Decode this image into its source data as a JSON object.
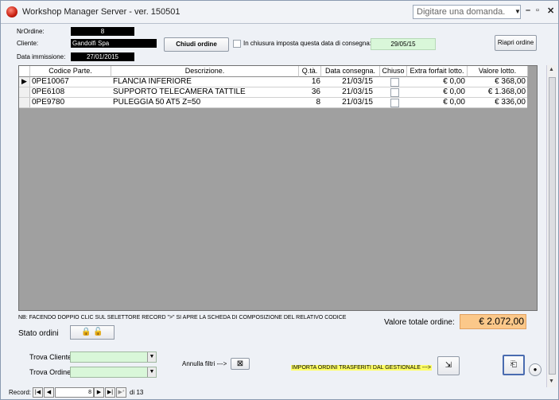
{
  "window": {
    "title": "Workshop Manager Server - ver. 150501",
    "help_placeholder": "Digitare una domanda.",
    "controls": {
      "minimize": "–",
      "restore": "▫",
      "close": "✕"
    }
  },
  "header": {
    "nr_ordine_label": "NrOrdine:",
    "nr_ordine_value": "8",
    "cliente_label": "Cliente:",
    "cliente_value": "Gandolfi Spa",
    "data_label": "Data immissione:",
    "data_value": "27/01/2015",
    "chiudi_button": "Chiudi ordine",
    "chiusura_label": "In chiusura imposta questa data di consegna:",
    "chiusura_date": "29/05/15",
    "riapri_button": "Riapri ordine"
  },
  "grid": {
    "columns": [
      "Codice Parte.",
      "Descrizione.",
      "Q.tà.",
      "Data consegna.",
      "Chiuso",
      "Extra forfait lotto.",
      "Valore lotto."
    ],
    "rows": [
      {
        "codice": "0PE10067",
        "descrizione": "FLANCIA INFERIORE",
        "qta": "16",
        "data": "21/03/15",
        "extra": "€ 0,00",
        "valore": "€ 368,00"
      },
      {
        "codice": "0PE6108",
        "descrizione": "SUPPORTO TELECAMERA TATTILE",
        "qta": "36",
        "data": "21/03/15",
        "extra": "€ 0,00",
        "valore": "€ 1.368,00"
      },
      {
        "codice": "0PE9780",
        "descrizione": "PULEGGIA 50 AT5 Z=50",
        "qta": "8",
        "data": "21/03/15",
        "extra": "€ 0,00",
        "valore": "€ 336,00"
      }
    ]
  },
  "footer": {
    "note": "NB: FACENDO DOPPIO CLIC SUL SELETTORE RECORD \">\" SI APRE LA SCHEDA DI COMPOSIZIONE DEL RELATIVO CODICE",
    "totale_label": "Valore totale ordine:",
    "totale_value": "€ 2.072,00",
    "stato_label": "Stato ordini",
    "trova_cliente_label": "Trova Cliente:",
    "trova_ordine_label": "Trova Ordine:",
    "annulla_label": "Annulla filtri --->",
    "importa_label": "IMPORTA ORDINI TRASFERITI DAL GESTIONALE --->"
  },
  "record_nav": {
    "label": "Record:",
    "current": "8",
    "total": "di 13"
  },
  "colors": {
    "accent_green": "#d9f7d9",
    "total_orange": "#fbc88a",
    "grid_bg": "#a0a0a0",
    "highlight_yellow": "#ffff66"
  }
}
